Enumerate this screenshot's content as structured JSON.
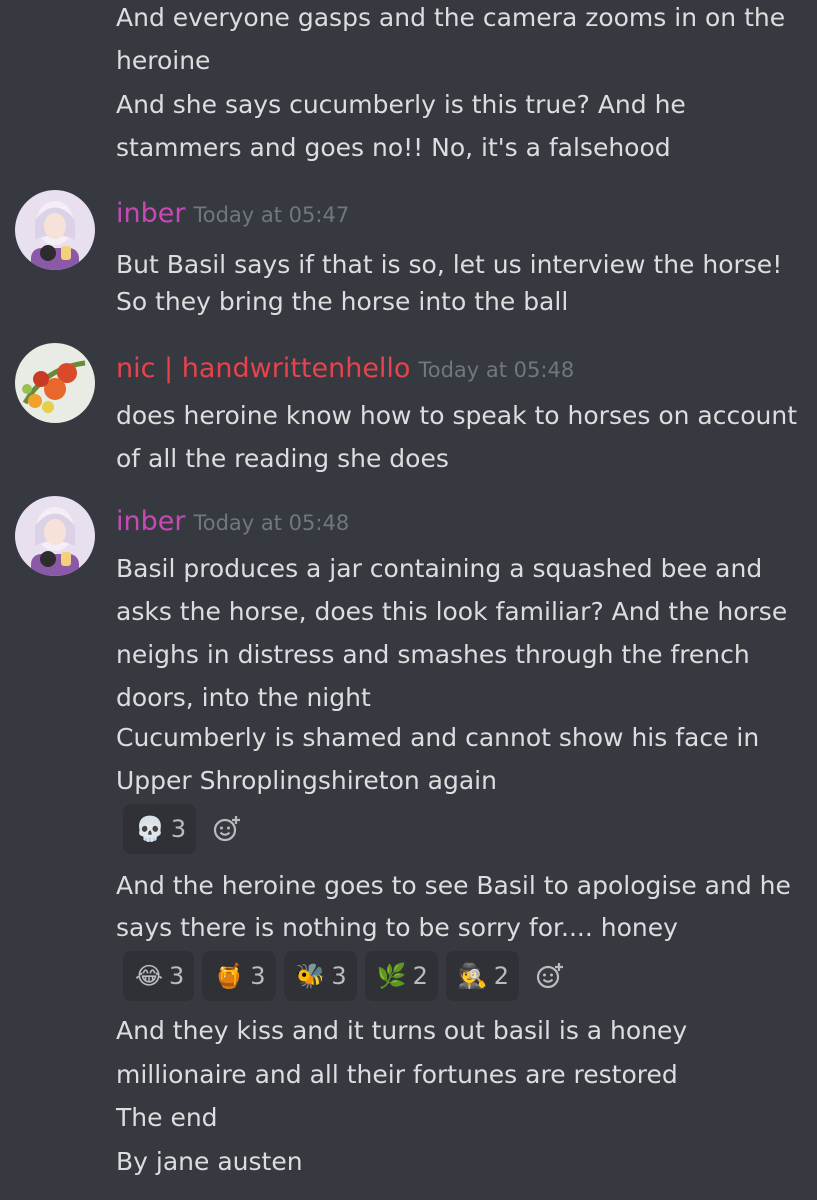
{
  "messages": [
    {
      "lines": [
        "And everyone gasps and the camera zooms in on the",
        "heroine",
        "And she says cucumberly is this true? And he",
        "stammers and goes no!! No, it's a falsehood"
      ]
    },
    {
      "username": "inber",
      "username_color": "#c849b6",
      "timestamp": "Today at 05:47",
      "lines": [
        "But Basil says if that is so, let us interview the horse!",
        "So they bring the horse into the ball"
      ]
    },
    {
      "username": "nic | handwrittenhello",
      "username_color": "#e8434c",
      "timestamp": "Today at 05:48",
      "lines": [
        "does heroine know how to speak to horses on account",
        "of all the reading she does"
      ]
    },
    {
      "username": "inber",
      "username_color": "#c849b6",
      "timestamp": "Today at 05:48",
      "lines": [
        "Basil produces a jar containing a squashed bee and",
        "asks the horse, does this look familiar? And the horse",
        "neighs in distress and smashes through the french",
        "doors, into the night",
        "Cucumberly is shamed and cannot show his face in",
        "Upper Shroplingshireton again"
      ],
      "reactions": [
        {
          "icon": "skull",
          "glyph": "💀",
          "count": "3"
        }
      ]
    },
    {
      "lines": [
        "And the heroine goes to see Basil to apologise and he",
        "says there is nothing to be sorry for.... honey"
      ],
      "reactions": [
        {
          "icon": "tears-of-joy",
          "glyph": "😂",
          "count": "3"
        },
        {
          "icon": "honey-pot",
          "glyph": "🍯",
          "count": "3"
        },
        {
          "icon": "bee",
          "glyph": "🐝",
          "count": "3"
        },
        {
          "icon": "herb",
          "glyph": "🌿",
          "count": "2"
        },
        {
          "icon": "detective",
          "glyph": "🕵",
          "count": "2"
        }
      ]
    },
    {
      "lines": [
        "And they kiss and it turns out basil is a honey",
        "millionaire and all their fortunes are restored",
        "The end",
        "By jane austen"
      ]
    }
  ]
}
